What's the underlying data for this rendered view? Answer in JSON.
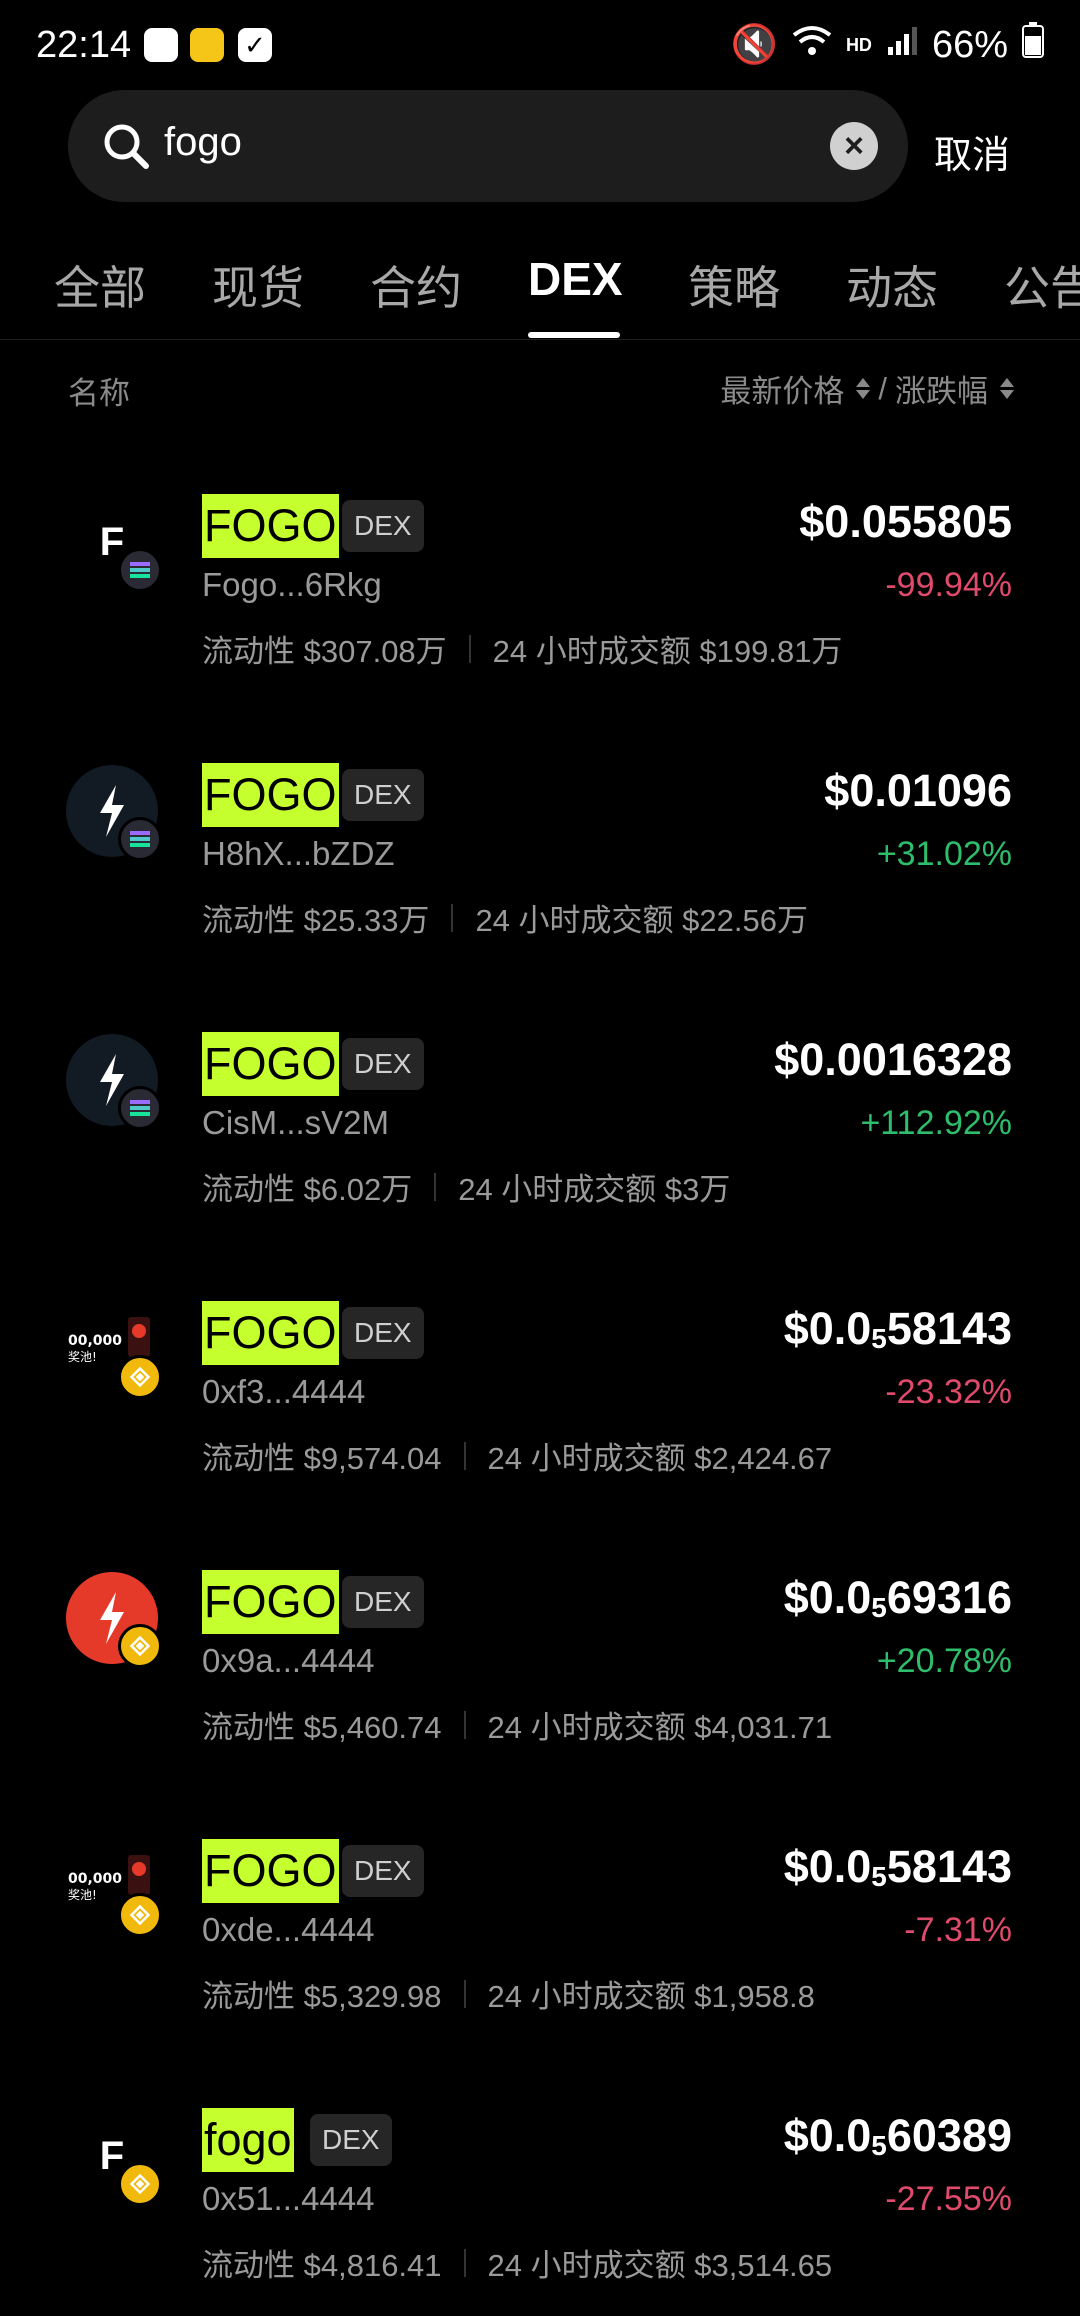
{
  "status_bar": {
    "time": "22:14",
    "network": "HD",
    "battery": "66%"
  },
  "search": {
    "query": "fogo",
    "cancel_label": "取消"
  },
  "tabs": [
    "全部",
    "现货",
    "合约",
    "DEX",
    "策略",
    "动态",
    "公告"
  ],
  "active_tab": "DEX",
  "columns": {
    "name": "名称",
    "price": "最新价格",
    "separator": "/",
    "change": "涨跌幅"
  },
  "rows": [
    {
      "symbol": "FOGO",
      "badge": "DEX",
      "address": "Fogo...6Rkg",
      "liquidity": "流动性 $307.08万",
      "volume": "24 小时成交额 $199.81万",
      "price": "$0.055805",
      "change": "-99.94%",
      "trend": "neg",
      "logo": "letter-f-logo",
      "chain": "solana-icon"
    },
    {
      "symbol": "FOGO",
      "badge": "DEX",
      "address": "H8hX...bZDZ",
      "liquidity": "流动性 $25.33万",
      "volume": "24 小时成交额 $22.56万",
      "price": "$0.01096",
      "change": "+31.02%",
      "trend": "pos",
      "logo": "bolt-logo",
      "chain": "solana-icon"
    },
    {
      "symbol": "FOGO",
      "badge": "DEX",
      "address": "CisM...sV2M",
      "liquidity": "流动性 $6.02万",
      "volume": "24 小时成交额 $3万",
      "price": "$0.0016328",
      "change": "+112.92%",
      "trend": "pos",
      "logo": "bolt-logo",
      "chain": "solana-icon"
    },
    {
      "symbol": "FOGO",
      "badge": "DEX",
      "address": "0xf3...4444",
      "liquidity": "流动性 $9,574.04",
      "volume": "24 小时成交额 $2,424.67",
      "price_prefix": "$0.0",
      "price_sub": "5",
      "price_rest": "58143",
      "change": "-23.32%",
      "trend": "neg",
      "logo": "prize-banner-logo",
      "chain": "bnb-icon"
    },
    {
      "symbol": "FOGO",
      "badge": "DEX",
      "address": "0x9a...4444",
      "liquidity": "流动性 $5,460.74",
      "volume": "24 小时成交额 $4,031.71",
      "price_prefix": "$0.0",
      "price_sub": "5",
      "price_rest": "69316",
      "change": "+20.78%",
      "trend": "pos",
      "logo": "red-bolt-logo",
      "chain": "bnb-icon"
    },
    {
      "symbol": "FOGO",
      "badge": "DEX",
      "address": "0xde...4444",
      "liquidity": "流动性 $5,329.98",
      "volume": "24 小时成交额 $1,958.8",
      "price_prefix": "$0.0",
      "price_sub": "5",
      "price_rest": "58143",
      "change": "-7.31%",
      "trend": "neg",
      "logo": "prize-banner-logo",
      "chain": "bnb-icon"
    },
    {
      "symbol": "fogo",
      "badge": "DEX",
      "address": "0x51...4444",
      "liquidity": "流动性 $4,816.41",
      "volume": "24 小时成交额 $3,514.65",
      "price_prefix": "$0.0",
      "price_sub": "5",
      "price_rest": "60389",
      "change": "-27.55%",
      "trend": "neg",
      "logo": "letter-f-logo",
      "chain": "bnb-icon"
    }
  ],
  "colors": {
    "highlight": "#c6ff2e",
    "negative": "#e04a6b",
    "positive": "#2ebd6b",
    "background": "#000000",
    "search_bg": "#1d1d1d"
  }
}
